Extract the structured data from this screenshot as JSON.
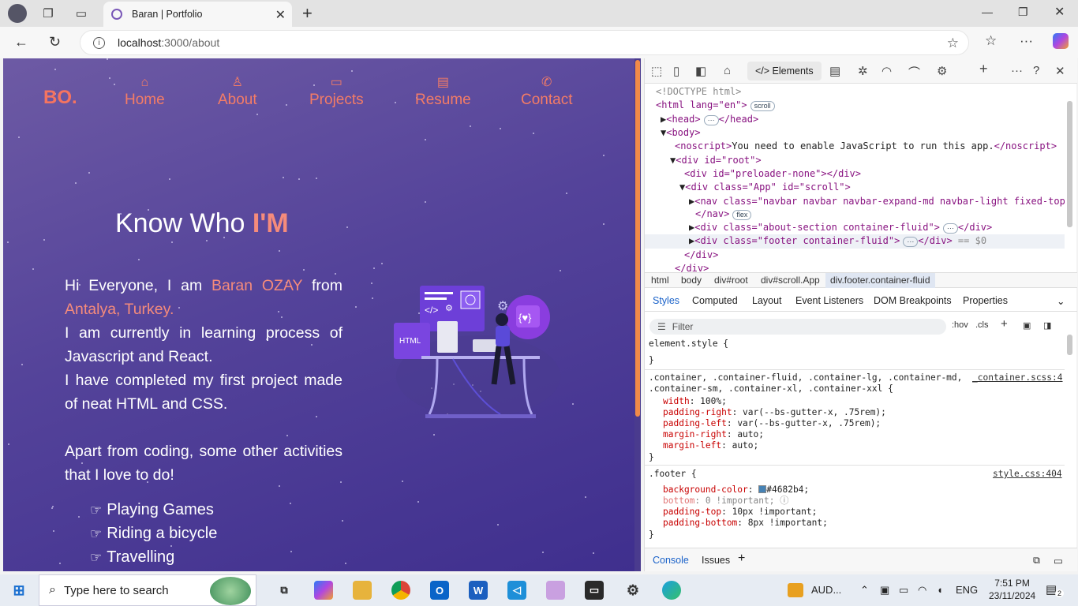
{
  "browser": {
    "tab_title": "Baran | Portfolio",
    "url_host": "localhost",
    "url_rest": ":3000/about"
  },
  "site": {
    "logo": "BO.",
    "nav": [
      {
        "label": "Home",
        "icon": "home-icon"
      },
      {
        "label": "About",
        "icon": "user-icon"
      },
      {
        "label": "Projects",
        "icon": "monitor-icon"
      },
      {
        "label": "Resume",
        "icon": "document-icon"
      },
      {
        "label": "Contact",
        "icon": "satellite-dish-icon"
      }
    ],
    "heading_prefix": "Know Who",
    "heading_highlight": "I'M",
    "intro_1": "Hi Everyone, I am",
    "name": "Baran OZAY",
    "intro_2": "from",
    "location": "Antalya, Turkey.",
    "line_learning": "I am currently in learning process of Javascript and React.",
    "line_project": "I have completed my first project made of neat HTML and CSS.",
    "line_apart": "Apart from coding, some other activities that I love to do!",
    "activities": [
      "Playing Games",
      "Riding a bicycle",
      "Travelling"
    ],
    "accent_color": "#f58b7b"
  },
  "devtools": {
    "elements_tab": "Elements",
    "dom": {
      "doctype": "<!DOCTYPE html>",
      "html_open": "<html lang=\"en\">",
      "html_badge": "scroll",
      "head": "<head>",
      "head_close": "</head>",
      "body": "<body>",
      "noscript_open": "<noscript>",
      "noscript_text": "You need to enable JavaScript to run this app.",
      "noscript_close": "</noscript>",
      "root": "<div id=\"root\">",
      "preloader": "<div id=\"preloader-none\"></div>",
      "app": "<div class=\"App\" id=\"scroll\">",
      "nav": "<nav class=\"navbar navbar navbar-expand-md navbar-light fixed-top\">",
      "nav_close": "</nav>",
      "nav_badge": "flex",
      "about": "<div class=\"about-section container-fluid\">",
      "about_close": "</div>",
      "footer": "<div class=\"footer container-fluid\">",
      "footer_close": "</div>",
      "footer_eq": "== $0",
      "div_close": "</div>",
      "div_close2": "</div>"
    },
    "breadcrumbs": [
      "html",
      "body",
      "div#root",
      "div#scroll.App",
      "div.footer.container-fluid"
    ],
    "panel_tabs": [
      "Styles",
      "Computed",
      "Layout",
      "Event Listeners",
      "DOM Breakpoints",
      "Properties"
    ],
    "filter_placeholder": "Filter",
    "filter_tools": [
      ":hov",
      ".cls"
    ],
    "element_style": "element.style {",
    "close_brace": "}",
    "container_selector_1": ".container, .container-fluid, .container-lg, .container-md,",
    "container_selector_2": ".container-sm, .container-xl, .container-xxl {",
    "container_source": "_container.scss:4",
    "container_props": [
      {
        "name": "width",
        "value": "100%;"
      },
      {
        "name": "padding-right",
        "value": "var(--bs-gutter-x, .75rem);"
      },
      {
        "name": "padding-left",
        "value": "var(--bs-gutter-x, .75rem);"
      },
      {
        "name": "margin-right",
        "value": "auto;"
      },
      {
        "name": "margin-left",
        "value": "auto;"
      }
    ],
    "footer_selector": ".footer {",
    "footer_source": "style.css:404",
    "footer_props": [
      {
        "name": "background-color",
        "value": "#4682b4;"
      },
      {
        "name": "bottom",
        "value": "0 !important;"
      },
      {
        "name": "padding-top",
        "value": "10px !important;"
      },
      {
        "name": "padding-bottom",
        "value": "8px !important;"
      }
    ],
    "swatch_color": "#4682b4",
    "drawer_tabs": [
      "Console",
      "Issues"
    ]
  },
  "taskbar": {
    "search_placeholder": "Type here to search",
    "tray_app": "AUD...",
    "language": "ENG",
    "time": "7:51 PM",
    "date": "23/11/2024",
    "notifications": "2"
  }
}
